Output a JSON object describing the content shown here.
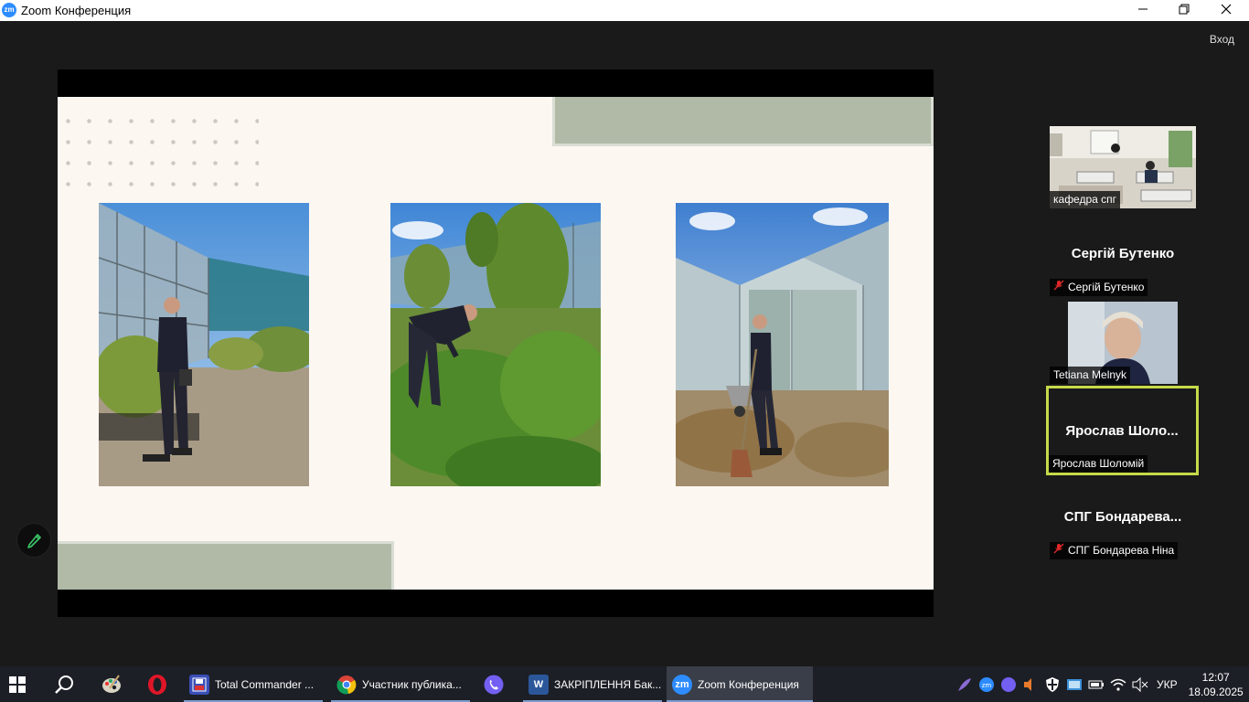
{
  "window": {
    "title": "Zoom Конференция",
    "logo_text": "zm"
  },
  "header": {
    "signin_label": "Вход"
  },
  "gallery": [
    {
      "label": "кафедра спг",
      "has_video": true,
      "muted": false
    },
    {
      "name": "Сергій Бутенко",
      "label": "Сергій Бутенко",
      "has_video": false,
      "muted": true
    },
    {
      "label": "Tetiana Melnyk",
      "has_video": true,
      "muted": false
    },
    {
      "name": "Ярослав  Шоло...",
      "label": "Ярослав Шоломій",
      "has_video": false,
      "muted": false,
      "active_speaker": true
    },
    {
      "name": "СПГ  Бондарева...",
      "label": "СПГ Бондарева Ніна",
      "has_video": false,
      "muted": true
    }
  ],
  "taskbar": {
    "apps": [
      {
        "label": "Total Commander ...",
        "icon": "floppy-icon"
      },
      {
        "label": "Участник публика...",
        "icon": "chrome-icon"
      },
      {
        "label": "ЗАКРІПЛЕННЯ Бак...",
        "icon": "word-icon"
      },
      {
        "label": "Zoom Конференция",
        "icon": "zoom-icon"
      }
    ],
    "language": "УКР",
    "time": "12:07",
    "date": "18.09.2025"
  },
  "colors": {
    "slide_bg": "#fdf7f2",
    "slide_band": "#b0baa7",
    "active_speaker_border": "#c6d94a",
    "zoom_blue": "#2d8cff"
  }
}
